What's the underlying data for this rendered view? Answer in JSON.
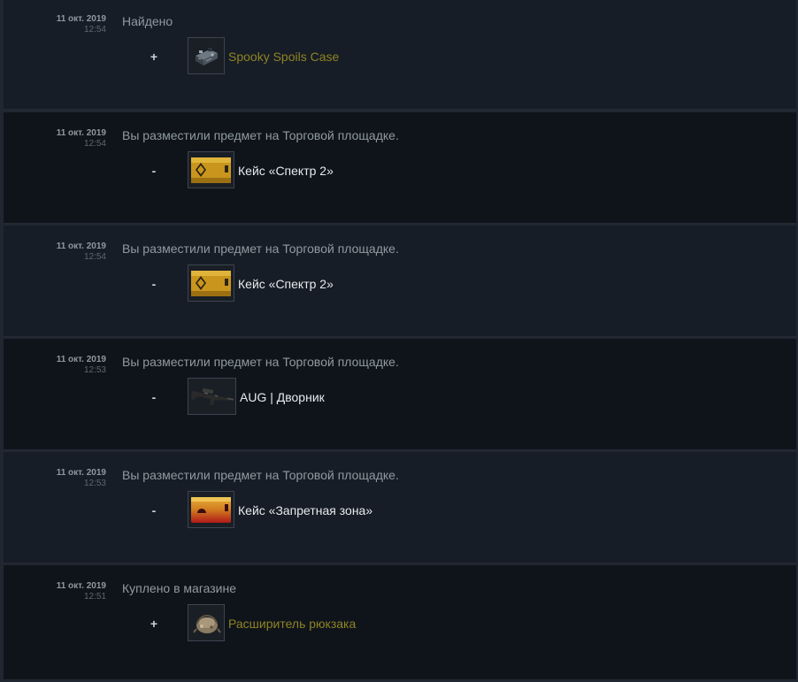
{
  "history": [
    {
      "date": "11 окт. 2019",
      "time": "12:54",
      "description": "Найдено",
      "sign": "+",
      "item_name": "Spooky Spoils Case",
      "item_color": "#8e8324",
      "icon": "spooky-case-icon"
    },
    {
      "date": "11 окт. 2019",
      "time": "12:54",
      "description": "Вы разместили предмет на Торговой площадке.",
      "sign": "-",
      "item_name": "Кейс «Спектр 2»",
      "item_color": "#e6eaed",
      "icon": "spectrum-2-case-icon"
    },
    {
      "date": "11 окт. 2019",
      "time": "12:54",
      "description": "Вы разместили предмет на Торговой площадке.",
      "sign": "-",
      "item_name": "Кейс «Спектр 2»",
      "item_color": "#e6eaed",
      "icon": "spectrum-2-case-icon"
    },
    {
      "date": "11 окт. 2019",
      "time": "12:53",
      "description": "Вы разместили предмет на Торговой площадке.",
      "sign": "-",
      "item_name": "AUG | Дворник",
      "item_color": "#e6eaed",
      "icon": "aug-rifle-icon"
    },
    {
      "date": "11 окт. 2019",
      "time": "12:53",
      "description": "Вы разместили предмет на Торговой площадке.",
      "sign": "-",
      "item_name": "Кейс «Запретная зона»",
      "item_color": "#e6eaed",
      "icon": "danger-zone-case-icon"
    },
    {
      "date": "11 окт. 2019",
      "time": "12:51",
      "description": "Куплено в магазине",
      "sign": "+",
      "item_name": "Расширитель рюкзака",
      "item_color": "#8e8324",
      "icon": "backpack-expander-icon"
    }
  ]
}
